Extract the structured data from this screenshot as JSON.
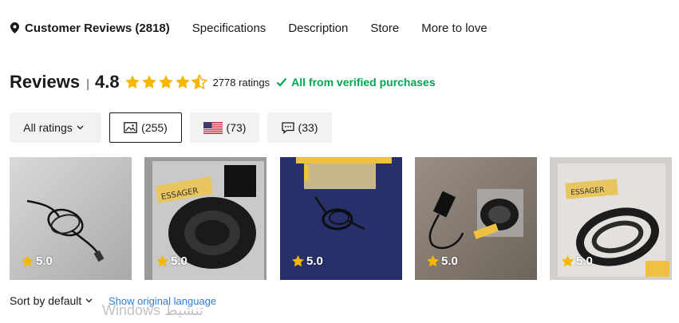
{
  "nav": {
    "items": [
      {
        "label": "Customer Reviews (2818)",
        "icon": "location-pin-icon",
        "active": true
      },
      {
        "label": "Specifications"
      },
      {
        "label": "Description"
      },
      {
        "label": "Store"
      },
      {
        "label": "More to love"
      }
    ]
  },
  "reviews": {
    "title": "Reviews",
    "separator": "|",
    "score": "4.8",
    "stars_value": 4.5,
    "stars_max": 5,
    "rating_count": "2778 ratings",
    "verified": "All from verified purchases"
  },
  "filters": {
    "all_ratings": "All ratings",
    "photos": "(255)",
    "country": "(73)",
    "comments": "(33)"
  },
  "thumbnails": [
    {
      "rating": "5.0"
    },
    {
      "rating": "5.0"
    },
    {
      "rating": "5.0"
    },
    {
      "rating": "5.0"
    },
    {
      "rating": "5.0"
    }
  ],
  "footer": {
    "sort": "Sort by default",
    "original_language": "Show original language",
    "watermark": "Windows تنشيط"
  },
  "colors": {
    "star": "#f6b700",
    "verified": "#00a650",
    "link": "#2e7dd8"
  }
}
